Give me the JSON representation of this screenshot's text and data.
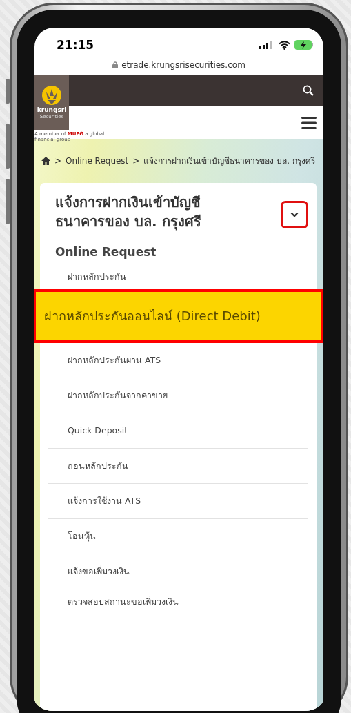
{
  "status_bar": {
    "time": "21:15"
  },
  "browser": {
    "url": "etrade.krungsrisecurities.com"
  },
  "header": {
    "logo": {
      "name": "krungsri",
      "subtitle": "Securities",
      "tagline_1": "A member of",
      "tagline_brand": "MUFG",
      "tagline_2": "a global financial group"
    }
  },
  "breadcrumb": {
    "separator": ">",
    "items": [
      "Online Request",
      "แจ้งการฝากเงินเข้าบัญชีธนาคารของ บล. กรุงศรี"
    ]
  },
  "menu_card": {
    "title": "แจ้งการฝากเงินเข้าบัญชีธนาคารของ บล. กรุงศรี",
    "dropdown_highlighted": true,
    "section": "Online Request",
    "items": [
      {
        "label": "ฝากหลักประกัน",
        "selected": false
      },
      {
        "label": "ฝากหลักประกันออนไลน์ (Direct Debit)",
        "selected": true
      },
      {
        "label": "ฝากหลักประกันผ่าน ATS",
        "selected": false
      },
      {
        "label": "ฝากหลักประกันจากค่าขาย",
        "selected": false
      },
      {
        "label": "Quick Deposit",
        "selected": false
      },
      {
        "label": "ถอนหลักประกัน",
        "selected": false
      },
      {
        "label": "แจ้งการใช้งาน ATS",
        "selected": false
      },
      {
        "label": "โอนหุ้น",
        "selected": false
      },
      {
        "label": "แจ้งขอเพิ่มวงเงิน",
        "selected": false
      },
      {
        "label": "ตรวจสอบสถานะขอเพิ่มวงเงิน",
        "selected": false
      }
    ]
  }
}
